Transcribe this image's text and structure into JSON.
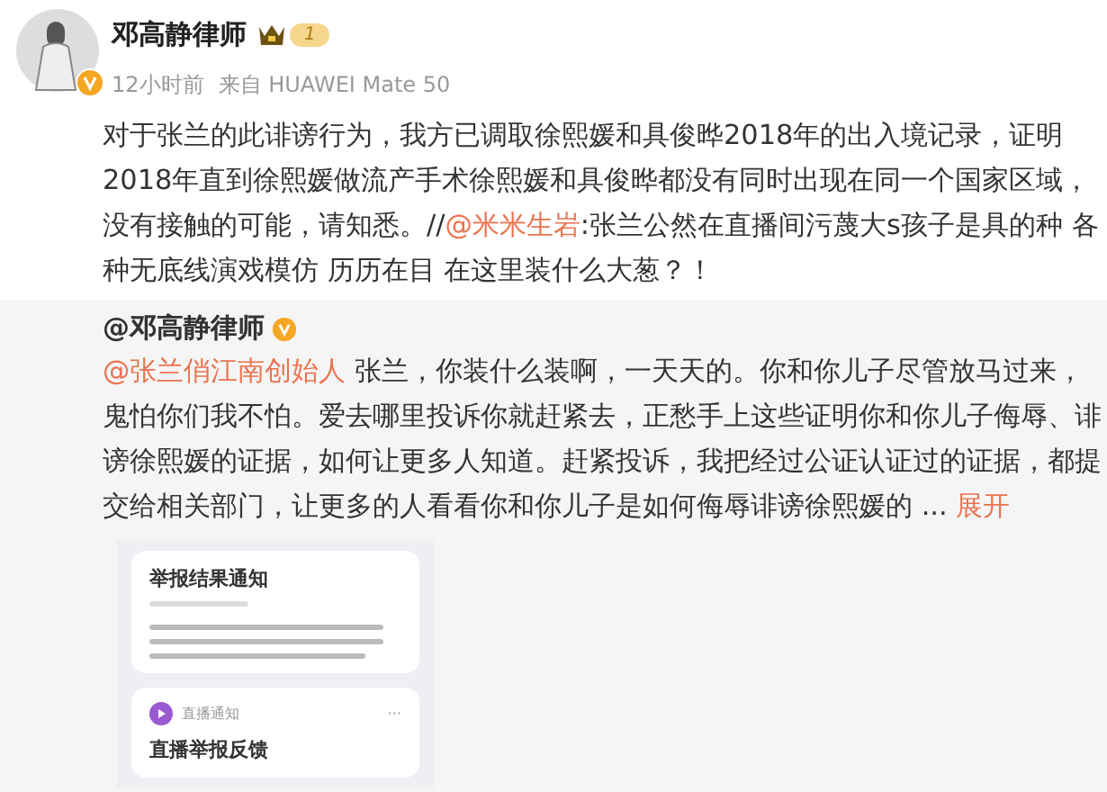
{
  "author": {
    "name": "邓高静律师",
    "level": "1",
    "time": "12小时前",
    "source": "来自 HUAWEI Mate 50"
  },
  "post": {
    "parts": [
      {
        "kind": "text",
        "text": "对于张兰的此诽谤行为，我方已调取徐熙媛和具俊晔2018年的出入境记录，证明2018年直到徐熙媛做流产手术徐熙媛和具俊晔都没有同时出现在同一个国家区域，没有接触的可能，请知悉。//"
      },
      {
        "kind": "mention",
        "text": "@米米生岩"
      },
      {
        "kind": "text",
        "text": ":张兰公然在直播间污蔑大s孩子是具的种 各种无底线演戏模仿 历历在目 在这里装什么大葱？！"
      }
    ]
  },
  "repost": {
    "author": "@邓高静律师",
    "parts": [
      {
        "kind": "mention",
        "text": "@张兰俏江南创始人"
      },
      {
        "kind": "text",
        "text": " 张兰，你装什么装啊，一天天的。你和你儿子尽管放马过来，鬼怕你们我不怕。爱去哪里投诉你就赶紧去，正愁手上这些证明你和你儿子侮辱、诽谤徐熙媛的证据，如何让更多人知道。赶紧投诉，我把经过公证认证过的证据，都提交给相关部门，让更多的人看看你和你儿子是如何侮辱诽谤徐熙媛的 ... "
      },
      {
        "kind": "more",
        "text": "展开"
      }
    ],
    "cards": [
      {
        "kind": "notice",
        "title": "举报结果通知"
      },
      {
        "kind": "live",
        "source": "直播通知",
        "menu": "···",
        "title": "直播举报反馈"
      }
    ]
  }
}
